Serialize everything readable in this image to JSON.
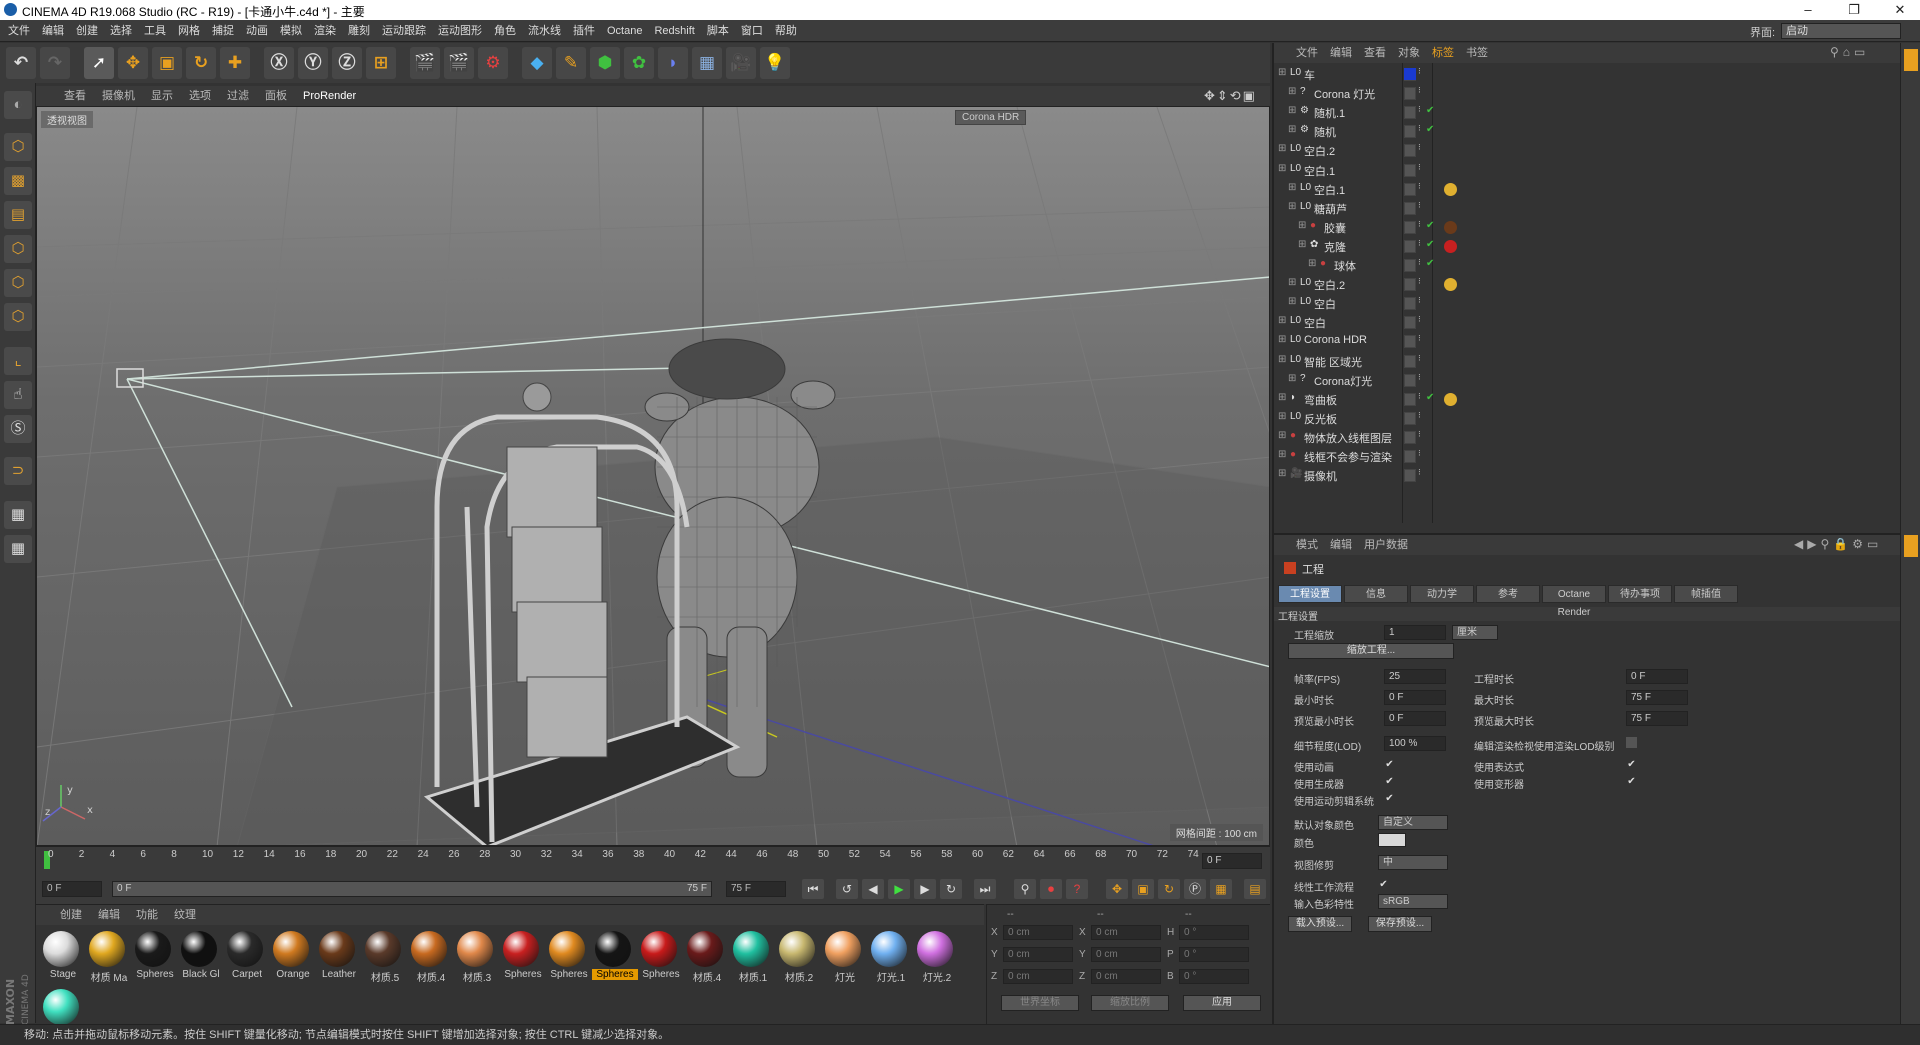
{
  "window": {
    "title": "CINEMA 4D R19.068 Studio (RC - R19) - [卡通小牛.c4d *] - 主要",
    "min": "–",
    "max": "❐",
    "close": "✕"
  },
  "menubar": {
    "items": [
      "文件",
      "编辑",
      "创建",
      "选择",
      "工具",
      "网格",
      "捕捉",
      "动画",
      "模拟",
      "渲染",
      "雕刻",
      "运动跟踪",
      "运动图形",
      "角色",
      "流水线",
      "插件",
      "Octane",
      "Redshift",
      "脚本",
      "窗口",
      "帮助"
    ],
    "interface_label": "界面:",
    "interface_value": "启动"
  },
  "viewport": {
    "menus": [
      "查看",
      "摄像机",
      "显示",
      "选项",
      "过滤",
      "面板",
      "ProRender"
    ],
    "label": "透视视图",
    "corona_badge": "Corona HDR",
    "grid_info": "网格间距 : 100 cm"
  },
  "timeline": {
    "ticks": [
      "0",
      "2",
      "4",
      "6",
      "8",
      "10",
      "12",
      "14",
      "16",
      "18",
      "20",
      "22",
      "24",
      "26",
      "28",
      "30",
      "32",
      "34",
      "36",
      "38",
      "40",
      "42",
      "44",
      "46",
      "48",
      "50",
      "52",
      "54",
      "56",
      "58",
      "60",
      "62",
      "64",
      "66",
      "68",
      "70",
      "72",
      "74"
    ],
    "current_frame": "0 F"
  },
  "transport": {
    "start": "0 F",
    "range_start": "0 F",
    "range_end": "75 F",
    "end": "75 F"
  },
  "materials": {
    "tabs": [
      "创建",
      "编辑",
      "功能",
      "纹理"
    ],
    "items": [
      {
        "label": "Stage",
        "color": "#dcdcdc"
      },
      {
        "label": "材质 Ma",
        "color": "#e0a820"
      },
      {
        "label": "Spheres",
        "color": "#1a1a1a"
      },
      {
        "label": "Black Gl",
        "color": "#101010"
      },
      {
        "label": "Carpet",
        "color": "#2a2a2a"
      },
      {
        "label": "Orange",
        "color": "#d07a20"
      },
      {
        "label": "Leather",
        "color": "#6a3a1a"
      },
      {
        "label": "材质.5",
        "color": "#5a3a2a"
      },
      {
        "label": "材质.4",
        "color": "#c86a20"
      },
      {
        "label": "材质.3",
        "color": "#e0884a"
      },
      {
        "label": "Spheres",
        "color": "#c82020"
      },
      {
        "label": "Spheres",
        "color": "#e08a20"
      },
      {
        "label": "Spheres",
        "color": "#151515"
      },
      {
        "label": "Spheres",
        "color": "#c81a1a"
      },
      {
        "label": "材质.4",
        "color": "#6a1a1a"
      },
      {
        "label": "材质.1",
        "color": "#20c0a0"
      },
      {
        "label": "材质.2",
        "color": "#c8b870"
      },
      {
        "label": "灯光",
        "color": "#f0a060"
      },
      {
        "label": "灯光.1",
        "color": "#70b0f0"
      },
      {
        "label": "灯光.2",
        "color": "#d070e0"
      },
      {
        "label": "",
        "color": "#40e0c0"
      }
    ],
    "selected_index": 12
  },
  "coords": {
    "head1": "--",
    "head2": "--",
    "head3": "--",
    "rows": [
      {
        "a": "X",
        "av": "0 cm",
        "b": "X",
        "bv": "0 cm",
        "c": "H",
        "cv": "0 °"
      },
      {
        "a": "Y",
        "av": "0 cm",
        "b": "Y",
        "bv": "0 cm",
        "c": "P",
        "cv": "0 °"
      },
      {
        "a": "Z",
        "av": "0 cm",
        "b": "Z",
        "bv": "0 cm",
        "c": "B",
        "cv": "0 °"
      }
    ],
    "world": "世界坐标",
    "scale": "缩放比例",
    "apply": "应用"
  },
  "status": "移动: 点击并拖动鼠标移动元素。按住 SHIFT 键量化移动; 节点编辑模式时按住 SHIFT 键增加选择对象; 按住 CTRL 键减少选择对象。",
  "objects": {
    "menus": [
      "文件",
      "编辑",
      "查看",
      "对象",
      "标签",
      "书签"
    ],
    "rows": [
      {
        "name": "车",
        "indent": 0
      },
      {
        "name": "Corona 灯光",
        "indent": 1
      },
      {
        "name": "随机.1",
        "indent": 1
      },
      {
        "name": "随机",
        "indent": 1
      },
      {
        "name": "空白.2",
        "indent": 0
      },
      {
        "name": "空白.1",
        "indent": 0
      },
      {
        "name": "空白.1",
        "indent": 1
      },
      {
        "name": "糖葫芦",
        "indent": 1
      },
      {
        "name": "胶囊",
        "indent": 2
      },
      {
        "name": "克隆",
        "indent": 2
      },
      {
        "name": "球体",
        "indent": 3
      },
      {
        "name": "空白.2",
        "indent": 1
      },
      {
        "name": "空白",
        "indent": 1
      },
      {
        "name": "空白",
        "indent": 0
      },
      {
        "name": "Corona HDR",
        "indent": 0
      },
      {
        "name": "智能 区域光",
        "indent": 0
      },
      {
        "name": "Corona灯光",
        "indent": 1
      },
      {
        "name": "弯曲板",
        "indent": 0
      },
      {
        "name": "反光板",
        "indent": 0
      },
      {
        "name": "物体放入线框图层",
        "indent": 0
      },
      {
        "name": "线框不会参与渲染",
        "indent": 0
      },
      {
        "name": "摄像机",
        "indent": 0
      }
    ]
  },
  "attributes": {
    "menus": [
      "模式",
      "编辑",
      "用户数据"
    ],
    "title": "工程",
    "tabs": [
      "工程设置",
      "信息",
      "动力学",
      "参考",
      "Octane Render",
      "待办事项",
      "帧插值"
    ],
    "section": "工程设置",
    "scale_label": "工程缩放",
    "scale_value": "1",
    "scale_unit": "厘米",
    "scale_btn": "缩放工程...",
    "fps_label": "帧率(FPS)",
    "fps": "25",
    "duration_label": "工程时长",
    "duration": "0 F",
    "min_label": "最小时长",
    "min": "0 F",
    "max_label": "最大时长",
    "max": "75 F",
    "pmin_label": "预览最小时长",
    "pmin": "0 F",
    "pmax_label": "预览最大时长",
    "pmax": "75 F",
    "lod_label": "细节程度(LOD)",
    "lod": "100 %",
    "lod_render_label": "编辑渲染检视使用渲染LOD级别",
    "use_anim": "使用动画",
    "use_expr": "使用表达式",
    "use_gen": "使用生成器",
    "use_deform": "使用变形器",
    "use_motion": "使用运动剪辑系统",
    "default_color_label": "默认对象颜色",
    "default_color_value": "自定义",
    "color_label": "颜色",
    "clip_label": "视图修剪",
    "clip_value": "中",
    "linear_label": "线性工作流程",
    "input_color_label": "输入色彩特性",
    "input_color_value": "sRGB",
    "load_btn": "载入预设...",
    "save_btn": "保存预设..."
  }
}
